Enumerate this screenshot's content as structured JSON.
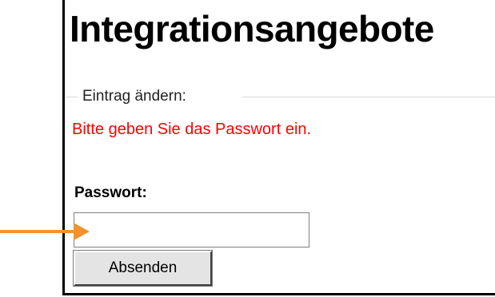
{
  "page": {
    "title": "Integrationsangebote"
  },
  "form": {
    "legend": "Eintrag ändern:",
    "error_message": "Bitte geben Sie das Passwort ein.",
    "password_label": "Passwort:",
    "password_value": "",
    "submit_label": "Absenden"
  },
  "annotation": {
    "arrow_color": "#f0922e",
    "error_color": "#ff0000"
  }
}
